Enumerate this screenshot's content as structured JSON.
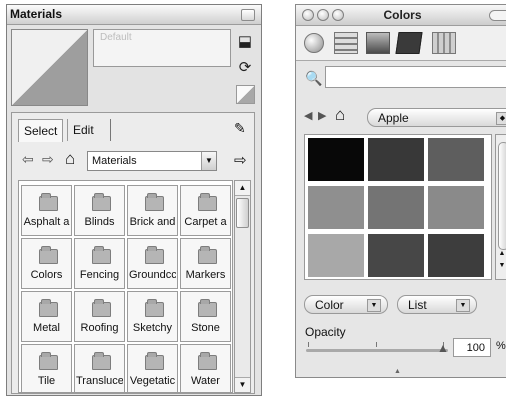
{
  "materials": {
    "title": "Materials",
    "name_placeholder": "Default",
    "tabs": [
      {
        "label": "Select"
      },
      {
        "label": "Edit"
      }
    ],
    "library": "Materials",
    "items": [
      "Asphalt a",
      "Blinds",
      "Brick and",
      "Carpet a",
      "Colors",
      "Fencing",
      "Groundcc",
      "Markers",
      "Metal",
      "Roofing",
      "Sketchy",
      "Stone",
      "Tile",
      "Transluce",
      "Vegetatic",
      "Water"
    ]
  },
  "colors": {
    "title": "Colors",
    "palette": "Apple",
    "swatches": [
      "#080808",
      "#383838",
      "#5e5e5e",
      "#8f8f8f",
      "#747474",
      "#8a8a8a",
      "#a8a8a8",
      "#474747",
      "#3d3d3d"
    ],
    "color_menu": "Color",
    "list_menu": "List",
    "opacity_label": "Opacity",
    "opacity_value": "100",
    "percent": "%"
  }
}
